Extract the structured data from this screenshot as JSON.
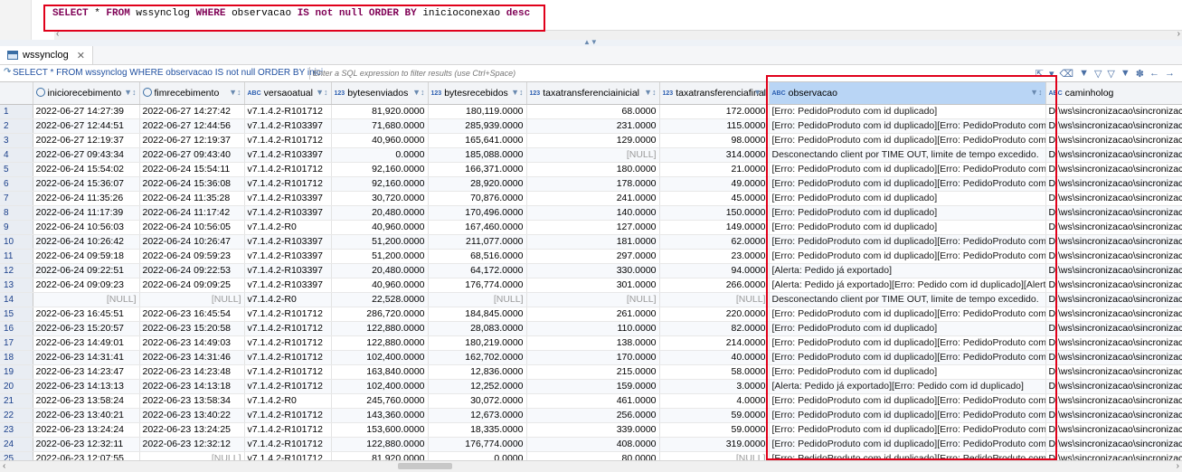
{
  "editor": {
    "sql_keyword_select": "SELECT",
    "sql_star": " * ",
    "sql_keyword_from": "FROM",
    "sql_table": " wssynclog ",
    "sql_keyword_where": "WHERE",
    "sql_cond": " observacao ",
    "sql_keyword_is": "IS not null",
    "sql_space": " ",
    "sql_keyword_order": "ORDER BY",
    "sql_col": " inicioconexao ",
    "sql_keyword_desc": "desc"
  },
  "tab": {
    "label": "wssynclog"
  },
  "filter": {
    "query_text": "SELECT * FROM wssynclog WHERE observacao IS not null ORDER BY inici",
    "placeholder": "Enter a SQL expression to filter results (use Ctrl+Space)"
  },
  "columns": [
    {
      "type": "clock",
      "name": "iniciorecebimento"
    },
    {
      "type": "clock",
      "name": "fimrecebimento"
    },
    {
      "type": "ABC",
      "name": "versaoatual"
    },
    {
      "type": "123",
      "name": "bytesenviados"
    },
    {
      "type": "123",
      "name": "bytesrecebidos"
    },
    {
      "type": "123",
      "name": "taxatransferenciainicial"
    },
    {
      "type": "123",
      "name": "taxatransferenciafinal"
    },
    {
      "type": "ABC",
      "name": "observacao"
    },
    {
      "type": "ABC",
      "name": "caminholog"
    }
  ],
  "rows": [
    [
      "1",
      "2022-06-27 14:27:39",
      "2022-06-27 14:27:42",
      "v7.1.4.2-R101712",
      "81,920.0000",
      "180,119.0000",
      "68.0000",
      "172.0000",
      "[Erro: PedidoProduto com id duplicado]",
      "D:\\ws\\sincronizacao\\sincronizacao"
    ],
    [
      "2",
      "2022-06-27 12:44:51",
      "2022-06-27 12:44:56",
      "v7.1.4.2-R103397",
      "71,680.0000",
      "285,939.0000",
      "231.0000",
      "115.0000",
      "[Erro: PedidoProduto com id duplicado][Erro: PedidoProduto com id dup",
      "D:\\ws\\sincronizacao\\sincronizacao"
    ],
    [
      "3",
      "2022-06-27 12:19:37",
      "2022-06-27 12:19:37",
      "v7.1.4.2-R101712",
      "40,960.0000",
      "165,641.0000",
      "129.0000",
      "98.0000",
      "[Erro: PedidoProduto com id duplicado][Erro: PedidoProduto com id dup",
      "D:\\ws\\sincronizacao\\sincronizacao"
    ],
    [
      "4",
      "2022-06-27 09:43:34",
      "2022-06-27 09:43:40",
      "v7.1.4.2-R103397",
      "0.0000",
      "185,088.0000",
      "[NULL]",
      "314.0000",
      "Desconectando client por TIME OUT, limite de tempo excedido.",
      "D:\\ws\\sincronizacao\\sincronizacao"
    ],
    [
      "5",
      "2022-06-24 15:54:02",
      "2022-06-24 15:54:11",
      "v7.1.4.2-R101712",
      "92,160.0000",
      "166,371.0000",
      "180.0000",
      "21.0000",
      "[Erro: PedidoProduto com id duplicado][Erro: PedidoProduto com id dup",
      "D:\\ws\\sincronizacao\\sincronizacao"
    ],
    [
      "6",
      "2022-06-24 15:36:07",
      "2022-06-24 15:36:08",
      "v7.1.4.2-R101712",
      "92,160.0000",
      "28,920.0000",
      "178.0000",
      "49.0000",
      "[Erro: PedidoProduto com id duplicado][Erro: PedidoProduto com id dup",
      "D:\\ws\\sincronizacao\\sincronizacao"
    ],
    [
      "7",
      "2022-06-24 11:35:26",
      "2022-06-24 11:35:28",
      "v7.1.4.2-R103397",
      "30,720.0000",
      "70,876.0000",
      "241.0000",
      "45.0000",
      "[Erro: PedidoProduto com id duplicado]",
      "D:\\ws\\sincronizacao\\sincronizacao"
    ],
    [
      "8",
      "2022-06-24 11:17:39",
      "2022-06-24 11:17:42",
      "v7.1.4.2-R103397",
      "20,480.0000",
      "170,496.0000",
      "140.0000",
      "150.0000",
      "[Erro: PedidoProduto com id duplicado]",
      "D:\\ws\\sincronizacao\\sincronizacao"
    ],
    [
      "9",
      "2022-06-24 10:56:03",
      "2022-06-24 10:56:05",
      "v7.1.4.2-R0",
      "40,960.0000",
      "167,460.0000",
      "127.0000",
      "149.0000",
      "[Erro: PedidoProduto com id duplicado]",
      "D:\\ws\\sincronizacao\\sincronizacao"
    ],
    [
      "10",
      "2022-06-24 10:26:42",
      "2022-06-24 10:26:47",
      "v7.1.4.2-R103397",
      "51,200.0000",
      "211,077.0000",
      "181.0000",
      "62.0000",
      "[Erro: PedidoProduto com id duplicado][Erro: PedidoProduto com id dup",
      "D:\\ws\\sincronizacao\\sincronizacao"
    ],
    [
      "11",
      "2022-06-24 09:59:18",
      "2022-06-24 09:59:23",
      "v7.1.4.2-R103397",
      "51,200.0000",
      "68,516.0000",
      "297.0000",
      "23.0000",
      "[Erro: PedidoProduto com id duplicado][Erro: PedidoProduto com id dup",
      "D:\\ws\\sincronizacao\\sincronizacao"
    ],
    [
      "12",
      "2022-06-24 09:22:51",
      "2022-06-24 09:22:53",
      "v7.1.4.2-R103397",
      "20,480.0000",
      "64,172.0000",
      "330.0000",
      "94.0000",
      "[Alerta: Pedido já exportado]",
      "D:\\ws\\sincronizacao\\sincronizacao"
    ],
    [
      "13",
      "2022-06-24 09:09:23",
      "2022-06-24 09:09:25",
      "v7.1.4.2-R103397",
      "40,960.0000",
      "176,774.0000",
      "301.0000",
      "266.0000",
      "[Alerta: Pedido já exportado][Erro: Pedido com id duplicado][Alerta: Pedi",
      "D:\\ws\\sincronizacao\\sincronizacao"
    ],
    [
      "14",
      "[NULL]",
      "[NULL]",
      "v7.1.4.2-R0",
      "22,528.0000",
      "[NULL]",
      "[NULL]",
      "[NULL]",
      "Desconectando client por TIME OUT, limite de tempo excedido.",
      "D:\\ws\\sincronizacao\\sincronizacao"
    ],
    [
      "15",
      "2022-06-23 16:45:51",
      "2022-06-23 16:45:54",
      "v7.1.4.2-R101712",
      "286,720.0000",
      "184,845.0000",
      "261.0000",
      "220.0000",
      "[Erro: PedidoProduto com id duplicado][Erro: PedidoProduto com id dup",
      "D:\\ws\\sincronizacao\\sincronizacao"
    ],
    [
      "16",
      "2022-06-23 15:20:57",
      "2022-06-23 15:20:58",
      "v7.1.4.2-R101712",
      "122,880.0000",
      "28,083.0000",
      "110.0000",
      "82.0000",
      "[Erro: PedidoProduto com id duplicado]",
      "D:\\ws\\sincronizacao\\sincronizacao"
    ],
    [
      "17",
      "2022-06-23 14:49:01",
      "2022-06-23 14:49:03",
      "v7.1.4.2-R101712",
      "122,880.0000",
      "180,219.0000",
      "138.0000",
      "214.0000",
      "[Erro: PedidoProduto com id duplicado][Erro: PedidoProduto com id dup",
      "D:\\ws\\sincronizacao\\sincronizacao"
    ],
    [
      "18",
      "2022-06-23 14:31:41",
      "2022-06-23 14:31:46",
      "v7.1.4.2-R101712",
      "102,400.0000",
      "162,702.0000",
      "170.0000",
      "40.0000",
      "[Erro: PedidoProduto com id duplicado][Erro: PedidoProduto com id dup",
      "D:\\ws\\sincronizacao\\sincronizacao"
    ],
    [
      "19",
      "2022-06-23 14:23:47",
      "2022-06-23 14:23:48",
      "v7.1.4.2-R101712",
      "163,840.0000",
      "12,836.0000",
      "215.0000",
      "58.0000",
      "[Erro: PedidoProduto com id duplicado]",
      "D:\\ws\\sincronizacao\\sincronizacao"
    ],
    [
      "20",
      "2022-06-23 14:13:13",
      "2022-06-23 14:13:18",
      "v7.1.4.2-R101712",
      "102,400.0000",
      "12,252.0000",
      "159.0000",
      "3.0000",
      "[Alerta: Pedido já exportado][Erro: Pedido com id duplicado]",
      "D:\\ws\\sincronizacao\\sincronizacao"
    ],
    [
      "21",
      "2022-06-23 13:58:24",
      "2022-06-23 13:58:34",
      "v7.1.4.2-R0",
      "245,760.0000",
      "30,072.0000",
      "461.0000",
      "4.0000",
      "[Erro: PedidoProduto com id duplicado][Erro: PedidoProduto com id dup",
      "D:\\ws\\sincronizacao\\sincronizacao"
    ],
    [
      "22",
      "2022-06-23 13:40:21",
      "2022-06-23 13:40:22",
      "v7.1.4.2-R101712",
      "143,360.0000",
      "12,673.0000",
      "256.0000",
      "59.0000",
      "[Erro: PedidoProduto com id duplicado][Erro: PedidoProduto com id dup",
      "D:\\ws\\sincronizacao\\sincronizacao"
    ],
    [
      "23",
      "2022-06-23 13:24:24",
      "2022-06-23 13:24:25",
      "v7.1.4.2-R101712",
      "153,600.0000",
      "18,335.0000",
      "339.0000",
      "59.0000",
      "[Erro: PedidoProduto com id duplicado][Erro: PedidoProduto com id dup",
      "D:\\ws\\sincronizacao\\sincronizacao"
    ],
    [
      "24",
      "2022-06-23 12:32:11",
      "2022-06-23 12:32:12",
      "v7.1.4.2-R101712",
      "122,880.0000",
      "176,774.0000",
      "408.0000",
      "319.0000",
      "[Erro: PedidoProduto com id duplicado][Erro: PedidoProduto com id dup",
      "D:\\ws\\sincronizacao\\sincronizacao"
    ],
    [
      "25",
      "2022-06-23 12:07:55",
      "[NULL]",
      "v7.1.4.2-R101712",
      "81,920.0000",
      "0.0000",
      "80.0000",
      "[NULL]",
      "[Erro: PedidoProduto com id duplicado][Erro: PedidoProduto com id dup",
      "D:\\ws\\sincronizacao\\sincronizacao"
    ],
    [
      "26",
      "2022-06-23 12:01:29",
      "2022-06-23 12:01:32",
      "v7.1.4.2-R101712",
      "71,680.0000",
      "183,522.0000",
      "131.0000",
      "170.0000",
      "[Erro: PedidoProduto com id duplicado][Erro: PedidoProduto com id dup",
      "D:\\ws\\sincronizacao\\sincronizacao"
    ]
  ],
  "colors": {
    "highlight": "#e0001a",
    "selected_header": "#b9d5f5",
    "link_blue": "#2050a0"
  }
}
